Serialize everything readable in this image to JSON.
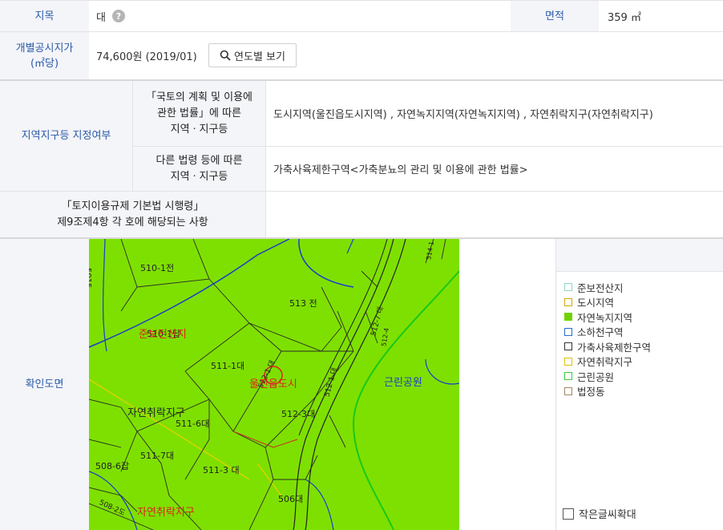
{
  "land": {
    "category_label": "지목",
    "category_value": "대",
    "help_icon": "?",
    "area_label": "면적",
    "area_value": "359 ㎡",
    "price_label_line1": "개별공시지가",
    "price_label_line2": "(㎡당)",
    "price_value": "74,600원 (2019/01)",
    "yearly_button": "연도별 보기"
  },
  "zoning": {
    "label": "지역지구등 지정여부",
    "sub1_line1": "「국토의 계획 및 이용에",
    "sub1_line2": "관한 법률」에 따른",
    "sub1_line3": "지역ㆍ지구등",
    "sub1_value": "도시지역(울진읍도시지역) , 자연녹지지역(자연녹지지역) , 자연취락지구(자연취락지구)",
    "sub2_line1": "다른 법령 등에 따른",
    "sub2_line2": "지역ㆍ지구등",
    "sub2_value": "가축사육제한구역<가축분뇨의 관리 및 이용에 관한 법률>",
    "reg_line1": "「토지이용규제 기본법 시행령」",
    "reg_line2": "제9조제4항 각 호에 해당되는 사항",
    "reg_value": ""
  },
  "map": {
    "label": "확인도면",
    "parcels": [
      "510-1전",
      "513 전",
      "511-1대",
      "512-3대",
      "511-6대",
      "511-7대",
      "508-6잡",
      "511-3 대",
      "506대",
      "5015",
      "512-1 대",
      "512-7 대",
      "512-1 대",
      "512-4",
      "508-2도",
      "514-1",
      "510-1답"
    ],
    "zones": [
      "준보전산지",
      "울진읍도시",
      "자연취락지구",
      "근린공원",
      "자연취락지구"
    ],
    "fill_color": "#7ee000",
    "legend": [
      {
        "label": "준보전산지",
        "color": "#8fd8c8",
        "filled": false
      },
      {
        "label": "도시지역",
        "color": "#d4a800",
        "filled": false
      },
      {
        "label": "자연녹지지역",
        "color": "#6fd200",
        "filled": true
      },
      {
        "label": "소하천구역",
        "color": "#2c6cc8",
        "filled": false
      },
      {
        "label": "가축사육제한구역",
        "color": "#333333",
        "filled": false
      },
      {
        "label": "자연취락지구",
        "color": "#e0c000",
        "filled": false
      },
      {
        "label": "근린공원",
        "color": "#3ac83a",
        "filled": false
      },
      {
        "label": "법정동",
        "color": "#a08860",
        "filled": false
      }
    ],
    "small_font_checkbox": "작은글씨확대"
  }
}
